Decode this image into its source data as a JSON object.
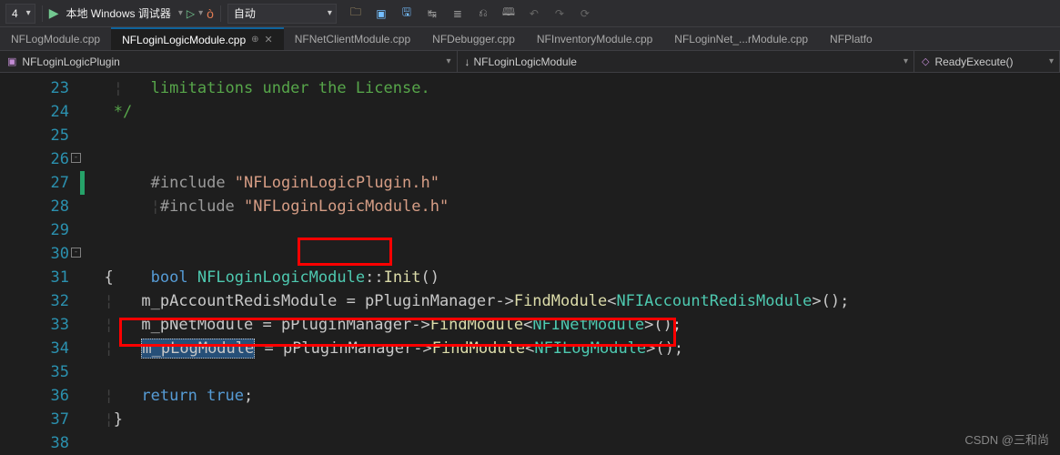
{
  "toolbar": {
    "config_left": "4",
    "debugger": "本地 Windows 调试器",
    "config_right": "自动"
  },
  "tabs": [
    {
      "label": "NFLogModule.cpp",
      "active": false
    },
    {
      "label": "NFLoginLogicModule.cpp",
      "active": true
    },
    {
      "label": "NFNetClientModule.cpp",
      "active": false
    },
    {
      "label": "NFDebugger.cpp",
      "active": false
    },
    {
      "label": "NFInventoryModule.cpp",
      "active": false
    },
    {
      "label": "NFLoginNet_...rModule.cpp",
      "active": false
    },
    {
      "label": "NFPlatfo",
      "active": false
    }
  ],
  "nav": {
    "scope": "NFLoginLogicPlugin",
    "class": "NFLoginLogicModule",
    "function": "ReadyExecute()"
  },
  "lines": {
    "n23": "23",
    "n24": "24",
    "n25": "25",
    "n26": "26",
    "n27": "27",
    "n28": "28",
    "n29": "29",
    "n30": "30",
    "n31": "31",
    "n32": "32",
    "n33": "33",
    "n34": "34",
    "n35": "35",
    "n36": "36",
    "n37": "37",
    "n38": "38"
  },
  "code": {
    "l23": "limitations under the License.",
    "l24": "*/",
    "inc_kw": "#include ",
    "l26_str": "\"NFLoginLogicPlugin.h\"",
    "l27_str": "\"NFLoginLogicModule.h\"",
    "l30_kw": "bool",
    "l30_cls": " NFLoginLogicModule",
    "l30_scope": "::",
    "l30_fn": "Init",
    "l30_paren": "()",
    "l31": "{",
    "l32_a": "m_pAccountRedisModule = pPluginManager->",
    "l32_fn": "FindModule",
    "l32_b": "<",
    "l32_t": "NFIAccountRedisModule",
    "l32_c": ">();",
    "l33_a": "m_pNetModule = pPluginManager->",
    "l33_t": "NFINetModule",
    "l34_var": "m_pLogModule",
    "l34_a": " = pPluginManager->",
    "l34_t": "NFILogModule",
    "l36_kw": "return",
    "l36_v": " true",
    "l36_semi": ";",
    "l37": "}"
  },
  "watermark": "CSDN @三和尚"
}
